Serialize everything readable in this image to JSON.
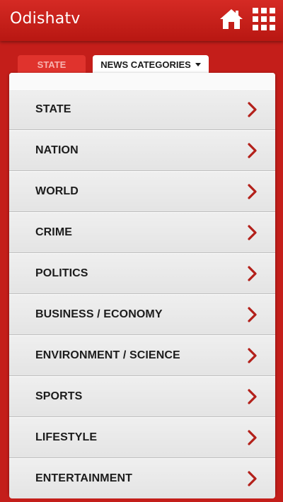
{
  "header": {
    "logo_text": "Odishatv",
    "home_icon": "home-icon",
    "menu_icon": "grid-menu-icon"
  },
  "tabs": {
    "state_label": "STATE",
    "news_categories_label": "NEWS CATEGORIES"
  },
  "categories": [
    {
      "label": "STATE"
    },
    {
      "label": "NATION"
    },
    {
      "label": "WORLD"
    },
    {
      "label": "CRIME"
    },
    {
      "label": "POLITICS"
    },
    {
      "label": "BUSINESS / ECONOMY"
    },
    {
      "label": "ENVIRONMENT / SCIENCE"
    },
    {
      "label": "SPORTS"
    },
    {
      "label": "LIFESTYLE"
    },
    {
      "label": "ENTERTAINMENT"
    }
  ],
  "colors": {
    "brand_red": "#c41e1a",
    "chevron_red": "#b3201a",
    "row_text": "#1c1c1c"
  }
}
